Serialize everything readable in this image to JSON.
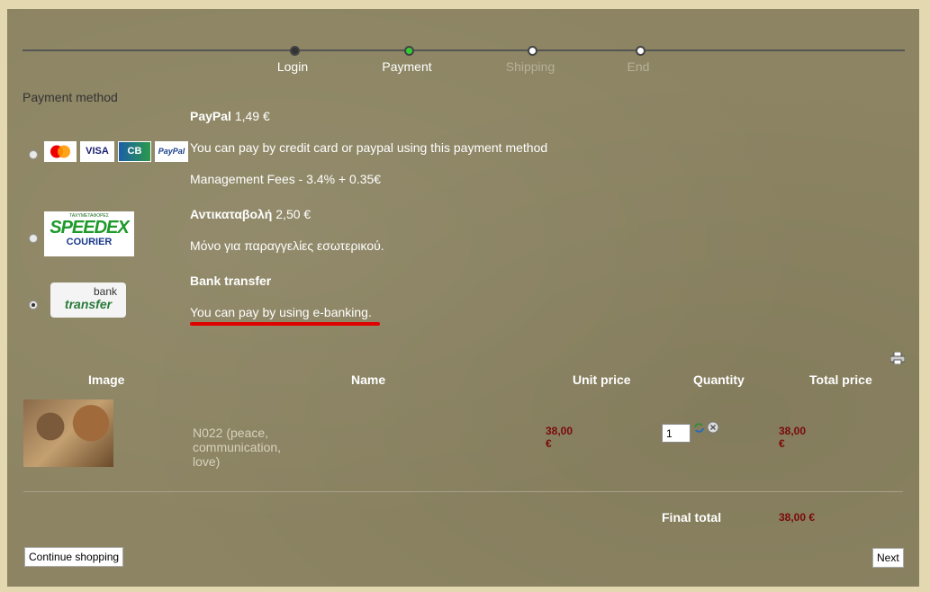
{
  "progress": {
    "steps": [
      {
        "label": "Login",
        "state": "done"
      },
      {
        "label": "Payment",
        "state": "current"
      },
      {
        "label": "Shipping",
        "state": "future"
      },
      {
        "label": "End",
        "state": "future"
      }
    ]
  },
  "payment": {
    "section_label": "Payment method",
    "methods": [
      {
        "name": "PayPal",
        "price": "1,49 €",
        "desc": "You can pay by credit card or paypal using this payment method",
        "fees": "Management Fees - 3.4% + 0.35€",
        "logos": [
          "MasterCard",
          "VISA",
          "CB",
          "PayPal"
        ],
        "selected": false
      },
      {
        "name": "Αντικαταβολή",
        "price": "2,50 €",
        "desc": "Μόνο για παραγγελίες εσωτερικού.",
        "logo_top": "ΤΑΧΥΜΕΤΑΦΟΡΕΣ",
        "logo_main": "SPEEDEX",
        "logo_sub": "COURIER",
        "selected": false
      },
      {
        "name": "Bank transfer",
        "desc": "You can pay by using e-banking.",
        "logo_top": "bank",
        "logo_main": "transfer",
        "selected": true
      }
    ]
  },
  "cart": {
    "headers": {
      "image": "Image",
      "name": "Name",
      "unit_price": "Unit price",
      "quantity": "Quantity",
      "total_price": "Total price"
    },
    "items": [
      {
        "name": "N022 (peace, communication, love)",
        "unit_price": "38,00 €",
        "quantity": "1",
        "total_price": "38,00 €"
      }
    ],
    "final_total_label": "Final total",
    "final_total": "38,00 €"
  },
  "buttons": {
    "continue": "Continue shopping",
    "next": "Next"
  },
  "colors": {
    "background": "#8c8462",
    "price": "#7a0a0a",
    "current_step": "#33cc33",
    "underline": "#e00000"
  }
}
